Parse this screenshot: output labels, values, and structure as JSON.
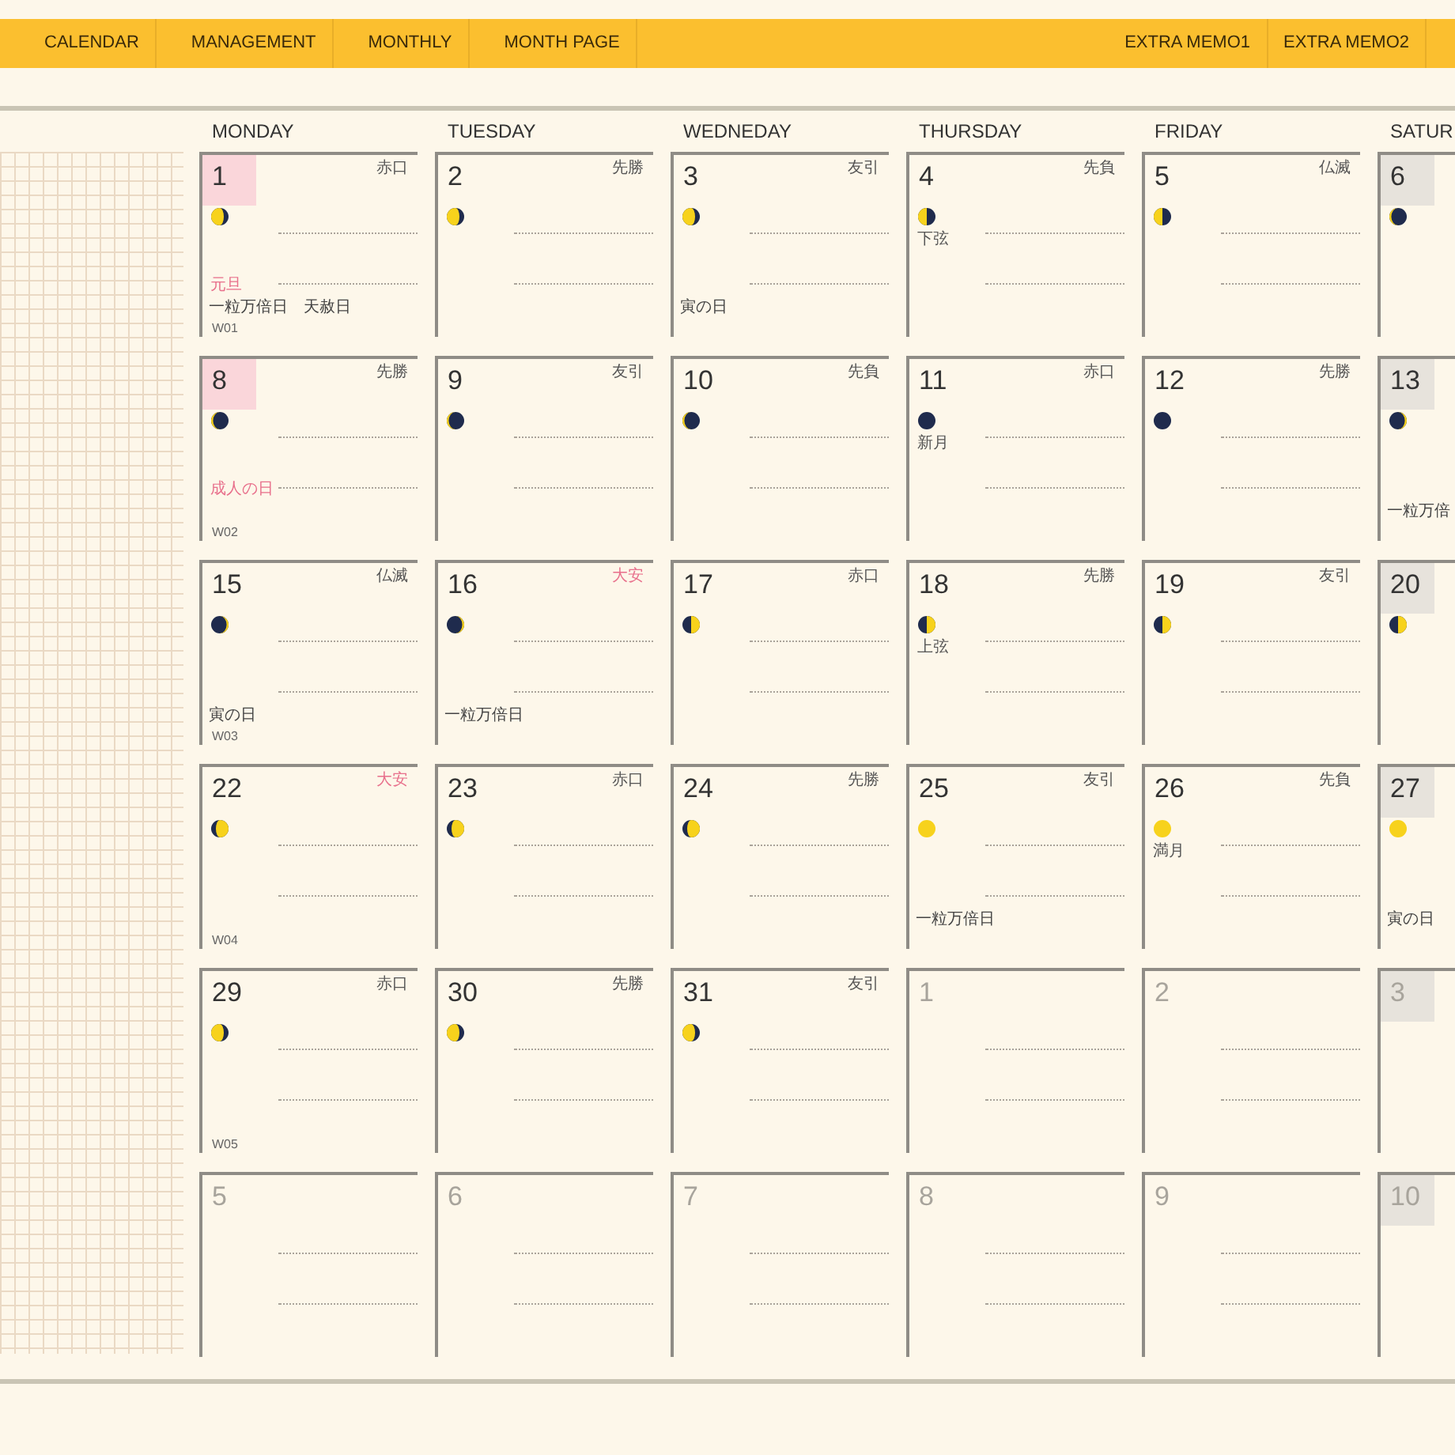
{
  "nav": {
    "left": [
      "CALENDAR",
      "MANAGEMENT",
      "MONTHLY",
      "MONTH PAGE"
    ],
    "right": [
      "EXTRA MEMO1",
      "EXTRA MEMO2"
    ]
  },
  "weekdays": [
    "MONDAY",
    "TUESDAY",
    "WEDNEDAY",
    "THURSDAY",
    "FRIDAY",
    "SATUR"
  ],
  "weeks": [
    {
      "label": "W01",
      "days": [
        {
          "day": "1",
          "muted": false,
          "red_day": true,
          "saturday": false,
          "rokuyo": "赤口",
          "rokuyo_red": false,
          "moon": {
            "kind": "waning_gibbous"
          },
          "holiday": "元旦",
          "notes": [
            "一粒万倍日",
            "天赦日"
          ]
        },
        {
          "day": "2",
          "muted": false,
          "red_day": false,
          "saturday": false,
          "rokuyo": "先勝",
          "rokuyo_red": false,
          "moon": {
            "kind": "waning_gibbous"
          }
        },
        {
          "day": "3",
          "muted": false,
          "red_day": false,
          "saturday": false,
          "rokuyo": "友引",
          "rokuyo_red": false,
          "moon": {
            "kind": "waning_gibbous"
          },
          "notes": [
            "寅の日"
          ]
        },
        {
          "day": "4",
          "muted": false,
          "red_day": false,
          "saturday": false,
          "rokuyo": "先負",
          "rokuyo_red": false,
          "moon": {
            "kind": "waning_half"
          },
          "moon_label": "下弦"
        },
        {
          "day": "5",
          "muted": false,
          "red_day": false,
          "saturday": false,
          "rokuyo": "仏滅",
          "rokuyo_red": false,
          "moon": {
            "kind": "waning_half"
          }
        },
        {
          "day": "6",
          "muted": false,
          "red_day": false,
          "saturday": true,
          "moon": {
            "kind": "waning_crescent"
          }
        }
      ]
    },
    {
      "label": "W02",
      "days": [
        {
          "day": "8",
          "muted": false,
          "red_day": true,
          "saturday": false,
          "rokuyo": "先勝",
          "rokuyo_red": false,
          "moon": {
            "kind": "waning_crescent"
          },
          "holiday": "成人の日"
        },
        {
          "day": "9",
          "muted": false,
          "red_day": false,
          "saturday": false,
          "rokuyo": "友引",
          "rokuyo_red": false,
          "moon": {
            "kind": "waning_crescent"
          }
        },
        {
          "day": "10",
          "muted": false,
          "red_day": false,
          "saturday": false,
          "rokuyo": "先負",
          "rokuyo_red": false,
          "moon": {
            "kind": "waning_crescent"
          }
        },
        {
          "day": "11",
          "muted": false,
          "red_day": false,
          "saturday": false,
          "rokuyo": "赤口",
          "rokuyo_red": false,
          "moon": {
            "kind": "new"
          },
          "moon_label": "新月"
        },
        {
          "day": "12",
          "muted": false,
          "red_day": false,
          "saturday": false,
          "rokuyo": "先勝",
          "rokuyo_red": false,
          "moon": {
            "kind": "new"
          }
        },
        {
          "day": "13",
          "muted": false,
          "red_day": false,
          "saturday": true,
          "moon": {
            "kind": "waxing_crescent"
          },
          "notes": [
            "一粒万倍"
          ]
        }
      ]
    },
    {
      "label": "W03",
      "days": [
        {
          "day": "15",
          "muted": false,
          "red_day": false,
          "saturday": false,
          "rokuyo": "仏滅",
          "rokuyo_red": false,
          "moon": {
            "kind": "waxing_crescent"
          },
          "notes": [
            "寅の日"
          ]
        },
        {
          "day": "16",
          "muted": false,
          "red_day": false,
          "saturday": false,
          "rokuyo": "大安",
          "rokuyo_red": true,
          "moon": {
            "kind": "waxing_crescent"
          },
          "notes": [
            "一粒万倍日"
          ]
        },
        {
          "day": "17",
          "muted": false,
          "red_day": false,
          "saturday": false,
          "rokuyo": "赤口",
          "rokuyo_red": false,
          "moon": {
            "kind": "waxing_half"
          }
        },
        {
          "day": "18",
          "muted": false,
          "red_day": false,
          "saturday": false,
          "rokuyo": "先勝",
          "rokuyo_red": false,
          "moon": {
            "kind": "waxing_half"
          },
          "moon_label": "上弦"
        },
        {
          "day": "19",
          "muted": false,
          "red_day": false,
          "saturday": false,
          "rokuyo": "友引",
          "rokuyo_red": false,
          "moon": {
            "kind": "waxing_half"
          }
        },
        {
          "day": "20",
          "muted": false,
          "red_day": false,
          "saturday": true,
          "moon": {
            "kind": "waxing_half"
          }
        }
      ]
    },
    {
      "label": "W04",
      "days": [
        {
          "day": "22",
          "muted": false,
          "red_day": false,
          "saturday": false,
          "rokuyo": "大安",
          "rokuyo_red": true,
          "moon": {
            "kind": "waxing_gibbous"
          }
        },
        {
          "day": "23",
          "muted": false,
          "red_day": false,
          "saturday": false,
          "rokuyo": "赤口",
          "rokuyo_red": false,
          "moon": {
            "kind": "waxing_gibbous"
          }
        },
        {
          "day": "24",
          "muted": false,
          "red_day": false,
          "saturday": false,
          "rokuyo": "先勝",
          "rokuyo_red": false,
          "moon": {
            "kind": "waxing_gibbous"
          }
        },
        {
          "day": "25",
          "muted": false,
          "red_day": false,
          "saturday": false,
          "rokuyo": "友引",
          "rokuyo_red": false,
          "moon": {
            "kind": "full"
          },
          "notes": [
            "一粒万倍日"
          ]
        },
        {
          "day": "26",
          "muted": false,
          "red_day": false,
          "saturday": false,
          "rokuyo": "先負",
          "rokuyo_red": false,
          "moon": {
            "kind": "full"
          },
          "moon_label": "満月"
        },
        {
          "day": "27",
          "muted": false,
          "red_day": false,
          "saturday": true,
          "moon": {
            "kind": "full"
          },
          "notes": [
            "寅の日"
          ]
        }
      ]
    },
    {
      "label": "W05",
      "days": [
        {
          "day": "29",
          "muted": false,
          "red_day": false,
          "saturday": false,
          "rokuyo": "赤口",
          "rokuyo_red": false,
          "moon": {
            "kind": "waning_gibbous"
          }
        },
        {
          "day": "30",
          "muted": false,
          "red_day": false,
          "saturday": false,
          "rokuyo": "先勝",
          "rokuyo_red": false,
          "moon": {
            "kind": "waning_gibbous"
          }
        },
        {
          "day": "31",
          "muted": false,
          "red_day": false,
          "saturday": false,
          "rokuyo": "友引",
          "rokuyo_red": false,
          "moon": {
            "kind": "waning_gibbous"
          }
        },
        {
          "day": "1",
          "muted": true,
          "red_day": false,
          "saturday": false
        },
        {
          "day": "2",
          "muted": true,
          "red_day": false,
          "saturday": false
        },
        {
          "day": "3",
          "muted": true,
          "red_day": false,
          "saturday": true
        }
      ]
    },
    {
      "days": [
        {
          "day": "5",
          "muted": true,
          "red_day": false,
          "saturday": false
        },
        {
          "day": "6",
          "muted": true,
          "red_day": false,
          "saturday": false
        },
        {
          "day": "7",
          "muted": true,
          "red_day": false,
          "saturday": false
        },
        {
          "day": "8",
          "muted": true,
          "red_day": false,
          "saturday": false
        },
        {
          "day": "9",
          "muted": true,
          "red_day": false,
          "saturday": false
        },
        {
          "day": "10",
          "muted": true,
          "red_day": false,
          "saturday": true
        }
      ]
    }
  ]
}
